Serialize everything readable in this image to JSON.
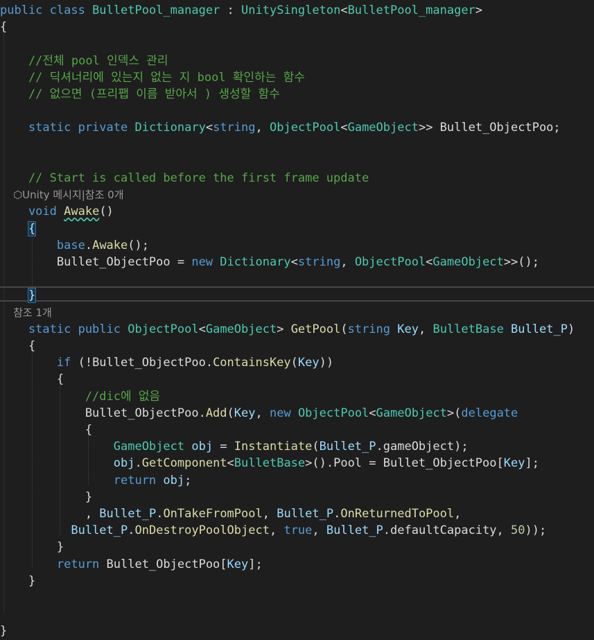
{
  "editor": {
    "lines": [
      [
        [
          "kw",
          "public class "
        ],
        [
          "cls",
          "BulletPool_manager"
        ],
        [
          "fg",
          " : "
        ],
        [
          "cls",
          "UnitySingleton"
        ],
        [
          "fg",
          "<"
        ],
        [
          "cls",
          "BulletPool_manager"
        ],
        [
          "fg",
          ">"
        ]
      ],
      [
        [
          "fg",
          "{"
        ]
      ],
      [],
      [
        [
          "cm",
          "    //전체 pool 인덱스 관리"
        ]
      ],
      [
        [
          "cm",
          "    // 딕셔너리에 있는지 없는 지 bool 확인하는 함수"
        ]
      ],
      [
        [
          "cm",
          "    // 없으면 (프리팹 이름 받아서 ) 생성할 함수"
        ]
      ],
      [],
      [
        [
          "kw",
          "    static private "
        ],
        [
          "cls",
          "Dictionary"
        ],
        [
          "fg",
          "<"
        ],
        [
          "kw",
          "string"
        ],
        [
          "fg",
          ", "
        ],
        [
          "cls",
          "ObjectPool"
        ],
        [
          "fg",
          "<"
        ],
        [
          "cls",
          "GameObject"
        ],
        [
          "fg",
          ">> Bullet_ObjectPoo;"
        ]
      ],
      [],
      [],
      [
        [
          "cm",
          "    // Start is called before the first frame update"
        ]
      ],
      [
        [
          "lens",
          "    ⬡Unity 메시지|참조 0개"
        ]
      ],
      [
        [
          "kw",
          "    void "
        ],
        [
          "sq",
          "Awake"
        ],
        [
          "fg",
          "()"
        ]
      ],
      [
        [
          "fgb",
          "    {"
        ]
      ],
      [
        [
          "kw",
          "        base"
        ],
        [
          "fg",
          "."
        ],
        [
          "fn",
          "Awake"
        ],
        [
          "fg",
          "();"
        ]
      ],
      [
        [
          "fg",
          "        Bullet_ObjectPoo = "
        ],
        [
          "kw",
          "new "
        ],
        [
          "cls",
          "Dictionary"
        ],
        [
          "fg",
          "<"
        ],
        [
          "kw",
          "string"
        ],
        [
          "fg",
          ", "
        ],
        [
          "cls",
          "ObjectPool"
        ],
        [
          "fg",
          "<"
        ],
        [
          "cls",
          "GameObject"
        ],
        [
          "fg",
          ">>();"
        ]
      ],
      [],
      [
        [
          "fgb",
          "    }"
        ]
      ],
      [
        [
          "lens",
          "    참조 1개"
        ]
      ],
      [
        [
          "kw",
          "    static public "
        ],
        [
          "cls",
          "ObjectPool"
        ],
        [
          "fg",
          "<"
        ],
        [
          "cls",
          "GameObject"
        ],
        [
          "fg",
          "> "
        ],
        [
          "fn",
          "GetPool"
        ],
        [
          "fg",
          "("
        ],
        [
          "kw",
          "string "
        ],
        [
          "par",
          "Key"
        ],
        [
          "fg",
          ", "
        ],
        [
          "cls",
          "BulletBase "
        ],
        [
          "par",
          "Bullet_P"
        ],
        [
          "fg",
          ")"
        ]
      ],
      [
        [
          "fg",
          "    {"
        ]
      ],
      [
        [
          "kw",
          "        if "
        ],
        [
          "fg",
          "(!Bullet_ObjectPoo."
        ],
        [
          "fn",
          "ContainsKey"
        ],
        [
          "fg",
          "("
        ],
        [
          "par",
          "Key"
        ],
        [
          "fg",
          "))"
        ]
      ],
      [
        [
          "fg",
          "        {"
        ]
      ],
      [
        [
          "cm",
          "            //dic에 없음"
        ]
      ],
      [
        [
          "fg",
          "            Bullet_ObjectPoo."
        ],
        [
          "fn",
          "Add"
        ],
        [
          "fg",
          "("
        ],
        [
          "par",
          "Key"
        ],
        [
          "fg",
          ", "
        ],
        [
          "kw",
          "new "
        ],
        [
          "cls",
          "ObjectPool"
        ],
        [
          "fg",
          "<"
        ],
        [
          "cls",
          "GameObject"
        ],
        [
          "fg",
          ">("
        ],
        [
          "kw",
          "delegate"
        ]
      ],
      [
        [
          "fg",
          "            {"
        ]
      ],
      [
        [
          "cls",
          "                GameObject "
        ],
        [
          "par",
          "obj"
        ],
        [
          "fg",
          " = "
        ],
        [
          "fn",
          "Instantiate"
        ],
        [
          "fg",
          "("
        ],
        [
          "par",
          "Bullet_P"
        ],
        [
          "fg",
          ".gameObject);"
        ]
      ],
      [
        [
          "par",
          "                obj"
        ],
        [
          "fg",
          "."
        ],
        [
          "fn",
          "GetComponent"
        ],
        [
          "fg",
          "<"
        ],
        [
          "cls",
          "BulletBase"
        ],
        [
          "fg",
          ">().Pool = Bullet_ObjectPoo["
        ],
        [
          "par",
          "Key"
        ],
        [
          "fg",
          "];"
        ]
      ],
      [
        [
          "kw",
          "                return "
        ],
        [
          "par",
          "obj"
        ],
        [
          "fg",
          ";"
        ]
      ],
      [
        [
          "fg",
          "            }"
        ]
      ],
      [
        [
          "fg",
          "            , "
        ],
        [
          "par",
          "Bullet_P"
        ],
        [
          "fg",
          "."
        ],
        [
          "fn",
          "OnTakeFromPool"
        ],
        [
          "fg",
          ", "
        ],
        [
          "par",
          "Bullet_P"
        ],
        [
          "fg",
          "."
        ],
        [
          "fn",
          "OnReturnedToPool"
        ],
        [
          "fg",
          ","
        ]
      ],
      [
        [
          "fg",
          "          "
        ],
        [
          "par",
          "Bullet_P"
        ],
        [
          "fg",
          "."
        ],
        [
          "fn",
          "OnDestroyPoolObject"
        ],
        [
          "fg",
          ", "
        ],
        [
          "kw",
          "true"
        ],
        [
          "fg",
          ", "
        ],
        [
          "par",
          "Bullet_P"
        ],
        [
          "fg",
          ".defaultCapacity, "
        ],
        [
          "num",
          "50"
        ],
        [
          "fg",
          "));"
        ]
      ],
      [
        [
          "fg",
          "        }"
        ]
      ],
      [
        [
          "kw",
          "        return "
        ],
        [
          "fg",
          "Bullet_ObjectPoo["
        ],
        [
          "par",
          "Key"
        ],
        [
          "fg",
          "];"
        ]
      ],
      [
        [
          "fg",
          "    }"
        ]
      ],
      [],
      [],
      [
        [
          "fg",
          "}"
        ]
      ]
    ],
    "colors": {
      "background": "#1e1e1e",
      "keyword": "#569cd6",
      "type": "#4ec9b0",
      "comment": "#57a64a",
      "method": "#dcdcaa",
      "parameter": "#9cdcfe",
      "number": "#b5cea8",
      "text": "#dcdcdc"
    }
  }
}
